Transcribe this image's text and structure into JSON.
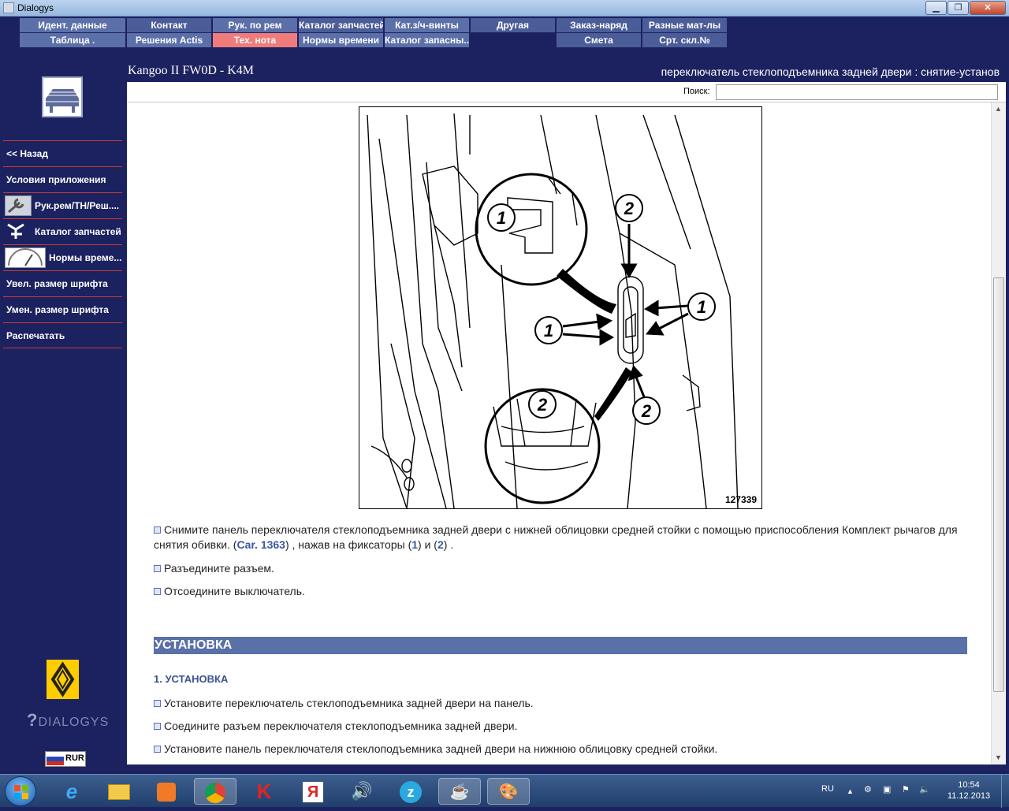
{
  "window": {
    "title": "Dialogys"
  },
  "nav": {
    "row1": [
      "Идент. данные",
      "Контакт",
      "Рук. по рем",
      "Каталог запчастей",
      "Кат.з/ч-винты",
      "Другая",
      "Заказ-наряд",
      "Разные мат-лы"
    ],
    "row2": [
      "Таблица .",
      "Решения Actis",
      "Тех. нота",
      "Нормы времени",
      "Каталог запасны...",
      "Смета",
      "Срт. скл.№"
    ]
  },
  "sidebar": {
    "items": [
      "<< Назад",
      "Условия приложения",
      "Рук.рем/ТН/Реш....",
      "Каталог запчастей",
      "Нормы време...",
      "Увел. размер шрифта",
      "Умен. размер шрифта",
      "Распечатать"
    ],
    "brand": "DIALOGYS",
    "currency": "RUR"
  },
  "header": {
    "vehicle": "Kangoo II FW0D - K4M",
    "operation": "переключатель стеклоподъемника задней двери : снятие-установ"
  },
  "search": {
    "label": "Поиск:",
    "value": ""
  },
  "figure": {
    "number": "127339",
    "callouts": [
      "1",
      "2",
      "1",
      "1",
      "2",
      "2"
    ]
  },
  "steps": {
    "removal": {
      "p1_a": "Снимите панель переключателя стеклоподъемника задней двери с нижней облицовки средней стойки с помощью приспособления Комплект рычагов для снятия обивки. (",
      "p1_tool": "Car. 1363",
      "p1_b": ") , нажав на фиксаторы (",
      "p1_ref1": "1",
      "p1_c": ") и (",
      "p1_ref2": "2",
      "p1_d": ") .",
      "p2": "Разъедините разъем.",
      "p3": "Отсоедините выключатель."
    },
    "section_title": "УСТАНОВКА",
    "sub_title": "1. УСТАНОВКА",
    "install": [
      "Установите переключатель стеклоподъемника задней двери на панель.",
      "Соедините разъем переключателя стеклоподъемника задней двери.",
      "Установите панель переключателя стеклоподъемника задней двери на нижнюю облицовку средней стойки."
    ]
  },
  "taskbar": {
    "apps": [
      "ie-icon",
      "explorer-icon",
      "media-player-icon",
      "chrome-icon",
      "kaspersky-icon",
      "yandex-icon",
      "volume-app-icon",
      "zona-icon",
      "java-icon",
      "paint-icon"
    ],
    "lang": "RU",
    "time": "10:54",
    "date": "11.12.2013"
  },
  "colors": {
    "background": "#1c2260",
    "nav_active": "#f07b7b",
    "section": "#5a70a8",
    "divider": "#c43c3c"
  }
}
